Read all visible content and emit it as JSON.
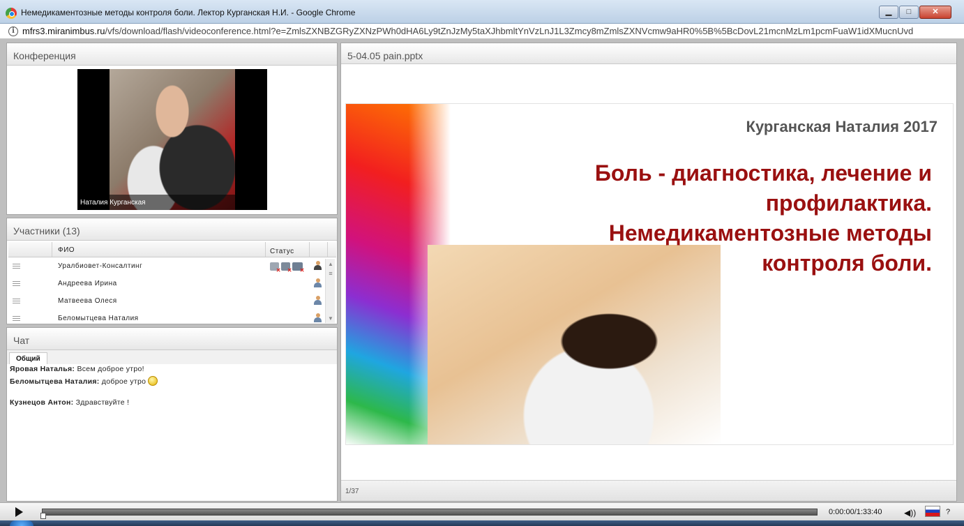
{
  "window": {
    "title": "Немедикаментозные методы контроля боли. Лектор Курганская Н.И. - Google Chrome",
    "controls": {
      "minimize": "▁",
      "maximize": "□",
      "close": "✕"
    }
  },
  "address": {
    "host": "mfrs3.miranimbus.ru",
    "path": "/vfs/download/flash/videoconference.html?e=ZmlsZXNBZGRyZXNzPWh0dHA6Ly9tZnJzMy5taXJhbmltYnVzLnJ1L3Zmcy8mZmlsZXNVcmw9aHR0%5B%5BcDovL21mcnMzLm1pcmFuaW1idXMucnUvd"
  },
  "conference": {
    "header": "Конференция",
    "video_caption": "Наталия Курганская"
  },
  "participants": {
    "header": "Участники (13)",
    "columns": {
      "name": "ФИО",
      "status": "Статус"
    },
    "rows": [
      {
        "name": "Уралбиовет-Консалтинг"
      },
      {
        "name": "Андреева Ирина"
      },
      {
        "name": "Матвеева Олеся"
      },
      {
        "name": "Беломытцева Наталия"
      }
    ]
  },
  "chat": {
    "header": "Чат",
    "tab": "Общий",
    "messages": [
      {
        "author": "Яровая Наталья:",
        "text": " Всем доброе утро!"
      },
      {
        "author": "Беломытцева Наталия:",
        "text": " доброе утро"
      },
      {
        "author": "Кузнецов Антон:",
        "text": " Здравствуйте !"
      }
    ]
  },
  "presentation": {
    "header": "5-04.05 pain.pptx",
    "slide_author": "Курганская Наталия 2017",
    "slide_title_lines": [
      "Боль - диагностика, лечение и",
      "профилактика.",
      "Немедикаментозные методы",
      "контроля боли."
    ],
    "page": "1/37"
  },
  "player": {
    "time": "0:00:00/1:33:40",
    "progress": 0.0,
    "help": "?"
  },
  "colors": {
    "slide_title": "#9a1010",
    "slide_author": "#555555",
    "close_button": "#c8432f"
  }
}
